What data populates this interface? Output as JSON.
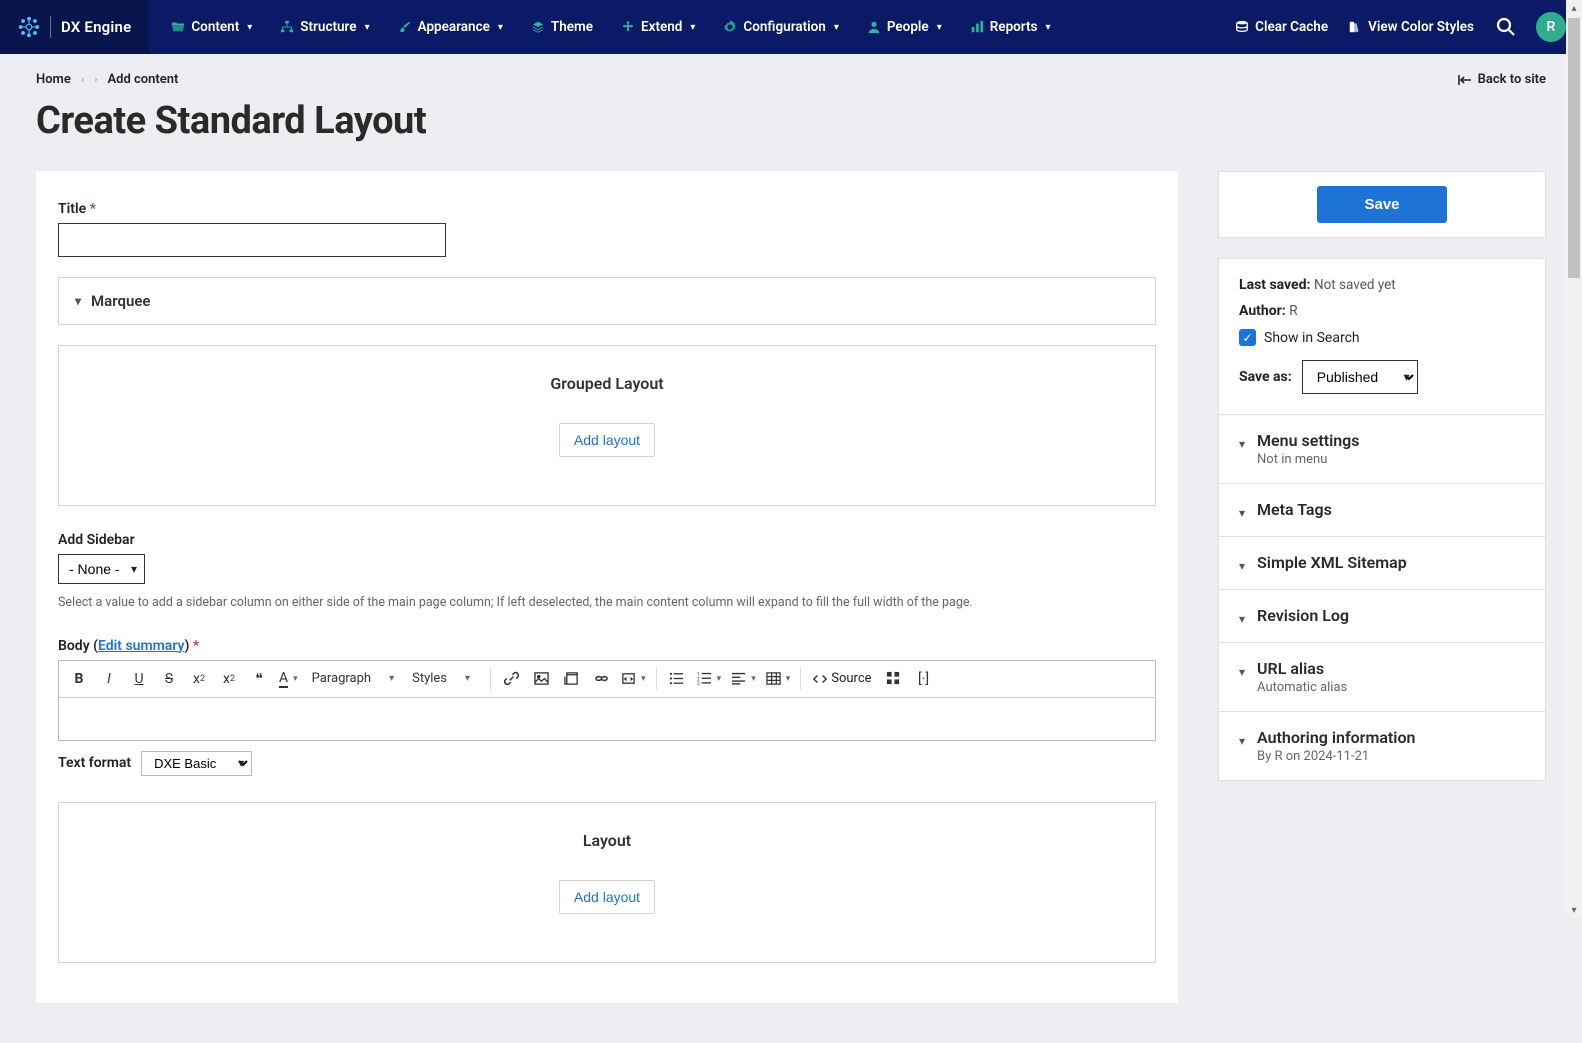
{
  "brand": {
    "name": "DX Engine"
  },
  "nav": [
    {
      "label": "Content",
      "caret": true
    },
    {
      "label": "Structure",
      "caret": true
    },
    {
      "label": "Appearance",
      "caret": true
    },
    {
      "label": "Theme",
      "caret": false
    },
    {
      "label": "Extend",
      "caret": true
    },
    {
      "label": "Configuration",
      "caret": true
    },
    {
      "label": "People",
      "caret": true
    },
    {
      "label": "Reports",
      "caret": true
    }
  ],
  "top_actions": {
    "clear_cache": "Clear Cache",
    "view_color_styles": "View Color Styles"
  },
  "avatar_initial": "R",
  "breadcrumb": {
    "home": "Home",
    "add_content": "Add content"
  },
  "back_to_site": "Back to site",
  "page_title": "Create Standard Layout",
  "form": {
    "title_label": "Title",
    "title_value": "",
    "marquee_label": "Marquee",
    "grouped_layout_heading": "Grouped Layout",
    "add_layout_btn": "Add layout",
    "add_sidebar_label": "Add Sidebar",
    "add_sidebar_value": "- None -",
    "add_sidebar_help": "Select a value to add a sidebar column on either side of the main page column; If left deselected, the main content column will expand to fill the full width of the page.",
    "body_label_prefix": "Body (",
    "edit_summary": "Edit summary",
    "body_label_suffix": ")",
    "toolbar": {
      "paragraph": "Paragraph",
      "styles": "Styles",
      "source": "Source"
    },
    "text_format_label": "Text format",
    "text_format_value": "DXE Basic",
    "layout_heading": "Layout"
  },
  "sidebar": {
    "save_btn": "Save",
    "last_saved_label": "Last saved:",
    "last_saved_value": "Not saved yet",
    "author_label": "Author:",
    "author_value": "R",
    "show_in_search": "Show in Search",
    "save_as_label": "Save as:",
    "save_as_value": "Published",
    "accordion": [
      {
        "title": "Menu settings",
        "sub": "Not in menu"
      },
      {
        "title": "Meta Tags",
        "sub": ""
      },
      {
        "title": "Simple XML Sitemap",
        "sub": ""
      },
      {
        "title": "Revision Log",
        "sub": ""
      },
      {
        "title": "URL alias",
        "sub": "Automatic alias"
      },
      {
        "title": "Authoring information",
        "sub": "By R on 2024-11-21"
      }
    ]
  }
}
